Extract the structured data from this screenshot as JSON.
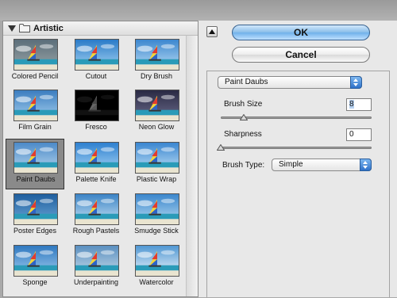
{
  "gallery": {
    "folder": "Artistic",
    "filters": [
      {
        "label": "Colored Pencil"
      },
      {
        "label": "Cutout"
      },
      {
        "label": "Dry Brush"
      },
      {
        "label": "Film Grain"
      },
      {
        "label": "Fresco"
      },
      {
        "label": "Neon Glow"
      },
      {
        "label": "Paint Daubs",
        "selected": true
      },
      {
        "label": "Palette Knife"
      },
      {
        "label": "Plastic Wrap"
      },
      {
        "label": "Poster Edges"
      },
      {
        "label": "Rough Pastels"
      },
      {
        "label": "Smudge Stick"
      },
      {
        "label": "Sponge"
      },
      {
        "label": "Underpainting"
      },
      {
        "label": "Watercolor"
      }
    ]
  },
  "buttons": {
    "ok": "OK",
    "cancel": "Cancel"
  },
  "settings": {
    "filter_select": "Paint Daubs",
    "brush_size": {
      "label": "Brush Size",
      "value": "8",
      "slider_fraction": 0.15
    },
    "sharpness": {
      "label": "Sharpness",
      "value": "0",
      "slider_fraction": 0.0
    },
    "brush_type": {
      "label": "Brush Type:",
      "value": "Simple"
    }
  },
  "icons": [
    "disclosure-triangle-icon",
    "folder-icon",
    "collapse-arrow-icon",
    "select-arrows-icon",
    "slider-knob-icon"
  ]
}
